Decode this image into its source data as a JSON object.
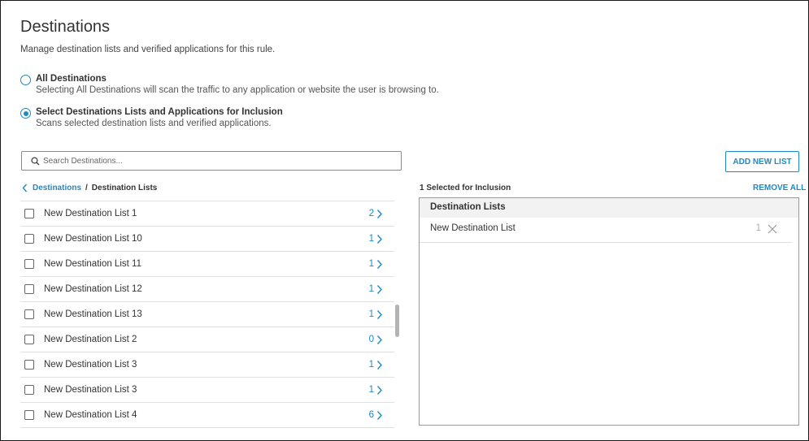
{
  "page": {
    "title": "Destinations",
    "description": "Manage destination lists and verified applications for this rule."
  },
  "options": [
    {
      "label": "All Destinations",
      "description": "Selecting All Destinations will scan the traffic to any application or website the user is browsing to.",
      "checked": false
    },
    {
      "label": "Select Destinations Lists and Applications for Inclusion",
      "description": "Scans selected destination lists and verified applications.",
      "checked": true
    }
  ],
  "search": {
    "placeholder": "Search Destinations..."
  },
  "add_button": {
    "label": "ADD NEW LIST"
  },
  "breadcrumb": {
    "link": "Destinations",
    "separator": "/",
    "current": "Destination Lists"
  },
  "destination_lists": [
    {
      "name": "New Destination List 1",
      "count": "2"
    },
    {
      "name": "New Destination List 10",
      "count": "1"
    },
    {
      "name": "New Destination List 11",
      "count": "1"
    },
    {
      "name": "New Destination List 12",
      "count": "1"
    },
    {
      "name": "New Destination List 13",
      "count": "1"
    },
    {
      "name": "New Destination List 2",
      "count": "0"
    },
    {
      "name": "New Destination List 3",
      "count": "1"
    },
    {
      "name": "New Destination List 3",
      "count": "1"
    },
    {
      "name": "New Destination List 4",
      "count": "6"
    }
  ],
  "selection": {
    "summary": "1 Selected for Inclusion",
    "remove_all_label": "REMOVE ALL",
    "panel_header": "Destination Lists",
    "items": [
      {
        "name": "New Destination List",
        "count": "1"
      }
    ]
  },
  "colors": {
    "accent": "#1b8ac6",
    "border": "#e0e0e0",
    "panel_header_bg": "#f2f2f2"
  },
  "icons": {
    "search": "search-icon",
    "back": "chevron-left-icon",
    "row": "chevron-right-icon",
    "remove": "close-icon"
  }
}
